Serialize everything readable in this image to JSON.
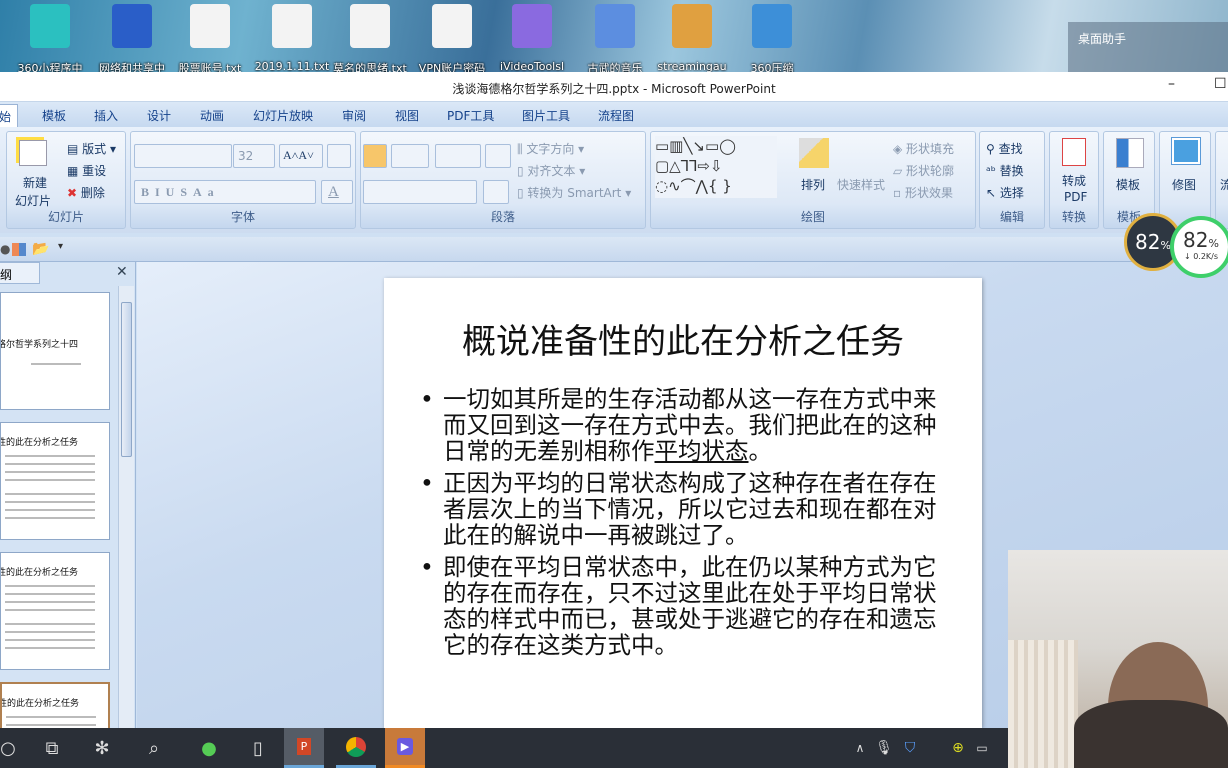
{
  "desktop": {
    "icons": [
      {
        "label": "360小程序中",
        "icon": "360-app-icon"
      },
      {
        "label": "网络和共享中",
        "icon": "network-icon"
      },
      {
        "label": "股票账号.txt",
        "icon": "text-file-icon"
      },
      {
        "label": "2019.1.11.txt",
        "icon": "text-file-icon"
      },
      {
        "label": "莫名的思绪.txt",
        "icon": "text-file-icon"
      },
      {
        "label": "VPN账户密码",
        "icon": "text-file-icon"
      },
      {
        "label": "iVideoToolsl",
        "icon": "video-tools-icon"
      },
      {
        "label": "古武的音乐",
        "icon": "owl-music-icon"
      },
      {
        "label": "streamingau",
        "icon": "streaming-icon"
      },
      {
        "label": "360压缩",
        "icon": "archive-icon"
      }
    ],
    "helper_title": "桌面助手"
  },
  "window": {
    "title": "浅谈海德格尔哲学系列之十四.pptx - Microsoft PowerPoint",
    "minimize": "–",
    "maximize": "☐"
  },
  "tabs": [
    "始",
    "模板",
    "插入",
    "设计",
    "动画",
    "幻灯片放映",
    "审阅",
    "视图",
    "PDF工具",
    "图片工具",
    "流程图"
  ],
  "ribbon": {
    "slides": {
      "label": "幻灯片",
      "new_slide": "新建",
      "new_slide2": "幻灯片",
      "layout": "版式",
      "reset": "重设",
      "delete": "删除"
    },
    "font": {
      "label": "字体",
      "font_name": "",
      "font_size": "32"
    },
    "paragraph": {
      "label": "段落",
      "text_direction": "文字方向",
      "align_text": "对齐文本",
      "smartart": "转换为 SmartArt"
    },
    "drawing": {
      "label": "绘图",
      "arrange": "排列",
      "quick_styles": "快速样式",
      "shape_fill": "形状填充",
      "shape_outline": "形状轮廓",
      "shape_effects": "形状效果"
    },
    "editing": {
      "label": "编辑",
      "find": "查找",
      "replace": "替换",
      "select": "选择"
    },
    "convert": {
      "label": "转换",
      "to_pdf": "转成",
      "to_pdf2": "PDF"
    },
    "template": {
      "label": "模板",
      "button": "模板"
    },
    "retouch": {
      "button": "修图"
    },
    "flow": {
      "button": "流"
    }
  },
  "outline_tab": "纲",
  "thumbnails": [
    {
      "title": "浅谈海德格尔哲学系列之十四"
    },
    {
      "title": "概说准备性的此在分析之任务"
    },
    {
      "title": "概说准备性的此在分析之任务"
    },
    {
      "title": "概说准备性的此在分析之任务"
    }
  ],
  "slide": {
    "title": "概说准备性的此在分析之任务",
    "bullets": [
      {
        "text": "一切如其所是的生存活动都从这一存在方式中来而又回到这一存在方式中去。我们把此在的这种日常的无差别相称作",
        "underlined": "平均状态",
        "end": "。"
      },
      {
        "text": "正因为平均的日常状态构成了这种存在者在存在者层次上的当下情况，所以它过去和现在都在对此在的解说中一再被跳过了。"
      },
      {
        "text": "即使在平均日常状态中，此在仍以某种方式为它的存在而存在，只不过这里此在处于平均日常状态的样式中而已，甚或处于逃避它的存在和遗忘它的存在这类方式中。"
      }
    ]
  },
  "speed_widget": {
    "percent1": "82",
    "percent2": "82",
    "unit": "%",
    "rate": "↓ 0.2K/s"
  },
  "taskbar": {
    "apps": [
      "cortana-icon",
      "task-view-icon",
      "fan-icon",
      "search-icon",
      "browser-360-icon",
      "file-icon",
      "powerpoint-icon",
      "chrome-icon",
      "video-app-icon"
    ],
    "tray": [
      "chevron-up-icon",
      "microphone-icon",
      "shield-icon",
      "plus-icon",
      "network-icon"
    ]
  },
  "colors": {
    "ribbon_text": "#15428b",
    "taskbar": "#2a2f37",
    "active_app": "#c87a3a"
  }
}
